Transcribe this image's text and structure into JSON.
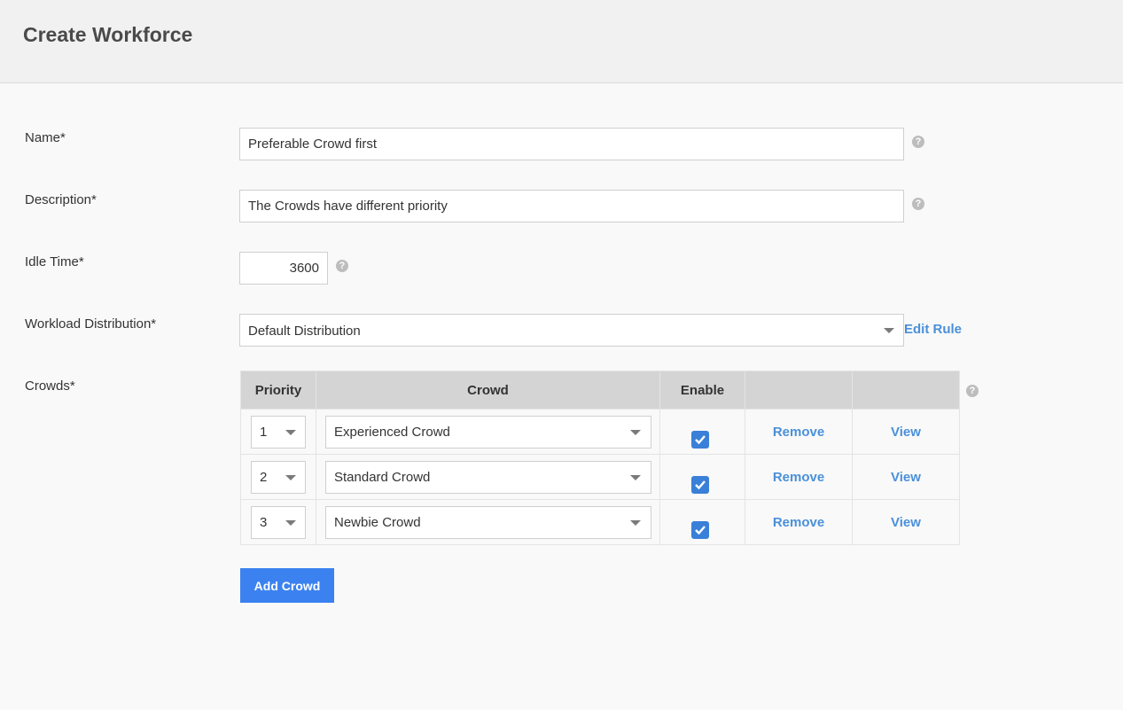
{
  "header": {
    "title": "Create Workforce"
  },
  "form": {
    "name": {
      "label": "Name*",
      "value": "Preferable Crowd first"
    },
    "description": {
      "label": "Description*",
      "value": "The Crowds have different priority"
    },
    "idle_time": {
      "label": "Idle Time*",
      "value": "3600"
    },
    "workload": {
      "label": "Workload Distribution*",
      "value": "Default Distribution",
      "edit_label": "Edit Rule"
    },
    "crowds_label": "Crowds*",
    "help_glyph": "?"
  },
  "crowds_table": {
    "headers": [
      "Priority",
      "Crowd",
      "Enable",
      "",
      ""
    ],
    "rows": [
      {
        "priority": "1",
        "crowd": "Experienced Crowd",
        "enabled": true,
        "remove": "Remove",
        "view": "View"
      },
      {
        "priority": "2",
        "crowd": "Standard Crowd",
        "enabled": true,
        "remove": "Remove",
        "view": "View"
      },
      {
        "priority": "3",
        "crowd": "Newbie Crowd",
        "enabled": true,
        "remove": "Remove",
        "view": "View"
      }
    ]
  },
  "actions": {
    "add_crowd": "Add Crowd"
  },
  "colors": {
    "accent": "#3b82f0",
    "link": "#4a90d9",
    "checkbox": "#3a7fd8"
  },
  "icons": [
    "help-icon",
    "chevron-down-icon",
    "checkmark-icon"
  ]
}
